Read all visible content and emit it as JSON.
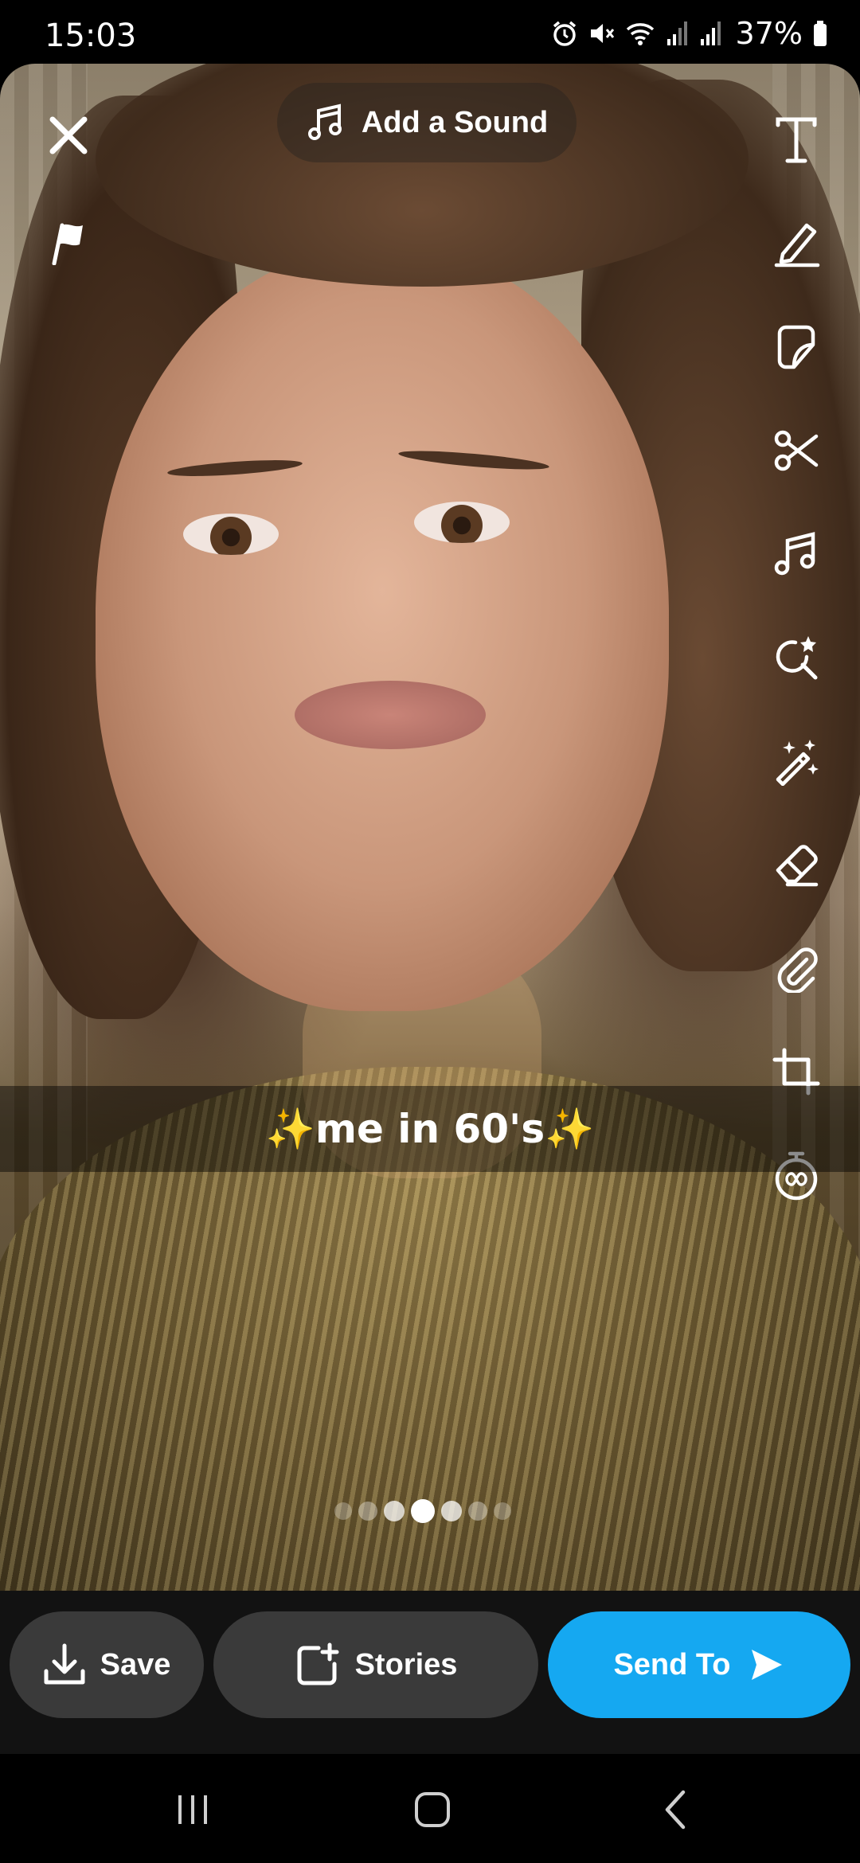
{
  "status_bar": {
    "time": "15:03",
    "battery": "37%",
    "icons": [
      "alarm-icon",
      "mute-icon",
      "wifi-icon",
      "signal-icon",
      "signal-icon",
      "battery-icon"
    ]
  },
  "top": {
    "add_sound_label": "Add a Sound",
    "close_icon": "close-icon",
    "flag_icon": "flag-icon"
  },
  "toolbar": {
    "tools": [
      "text-icon",
      "pencil-icon",
      "sticker-icon",
      "scissors-icon",
      "music-icon",
      "lens-search-icon",
      "magic-wand-icon",
      "eraser-icon",
      "paperclip-icon",
      "crop-icon",
      "timer-icon"
    ]
  },
  "caption": {
    "text": "✨me in 60's✨"
  },
  "pagination": {
    "total": 7,
    "active_index": 3
  },
  "actions": {
    "save_label": "Save",
    "stories_label": "Stories",
    "send_label": "Send To"
  },
  "colors": {
    "send_button": "#15a8f1",
    "action_bar_bg": "#121212",
    "pill_bg": "#3a3a3a"
  },
  "nav": {
    "items": [
      "recents-icon",
      "home-icon",
      "back-icon"
    ]
  }
}
